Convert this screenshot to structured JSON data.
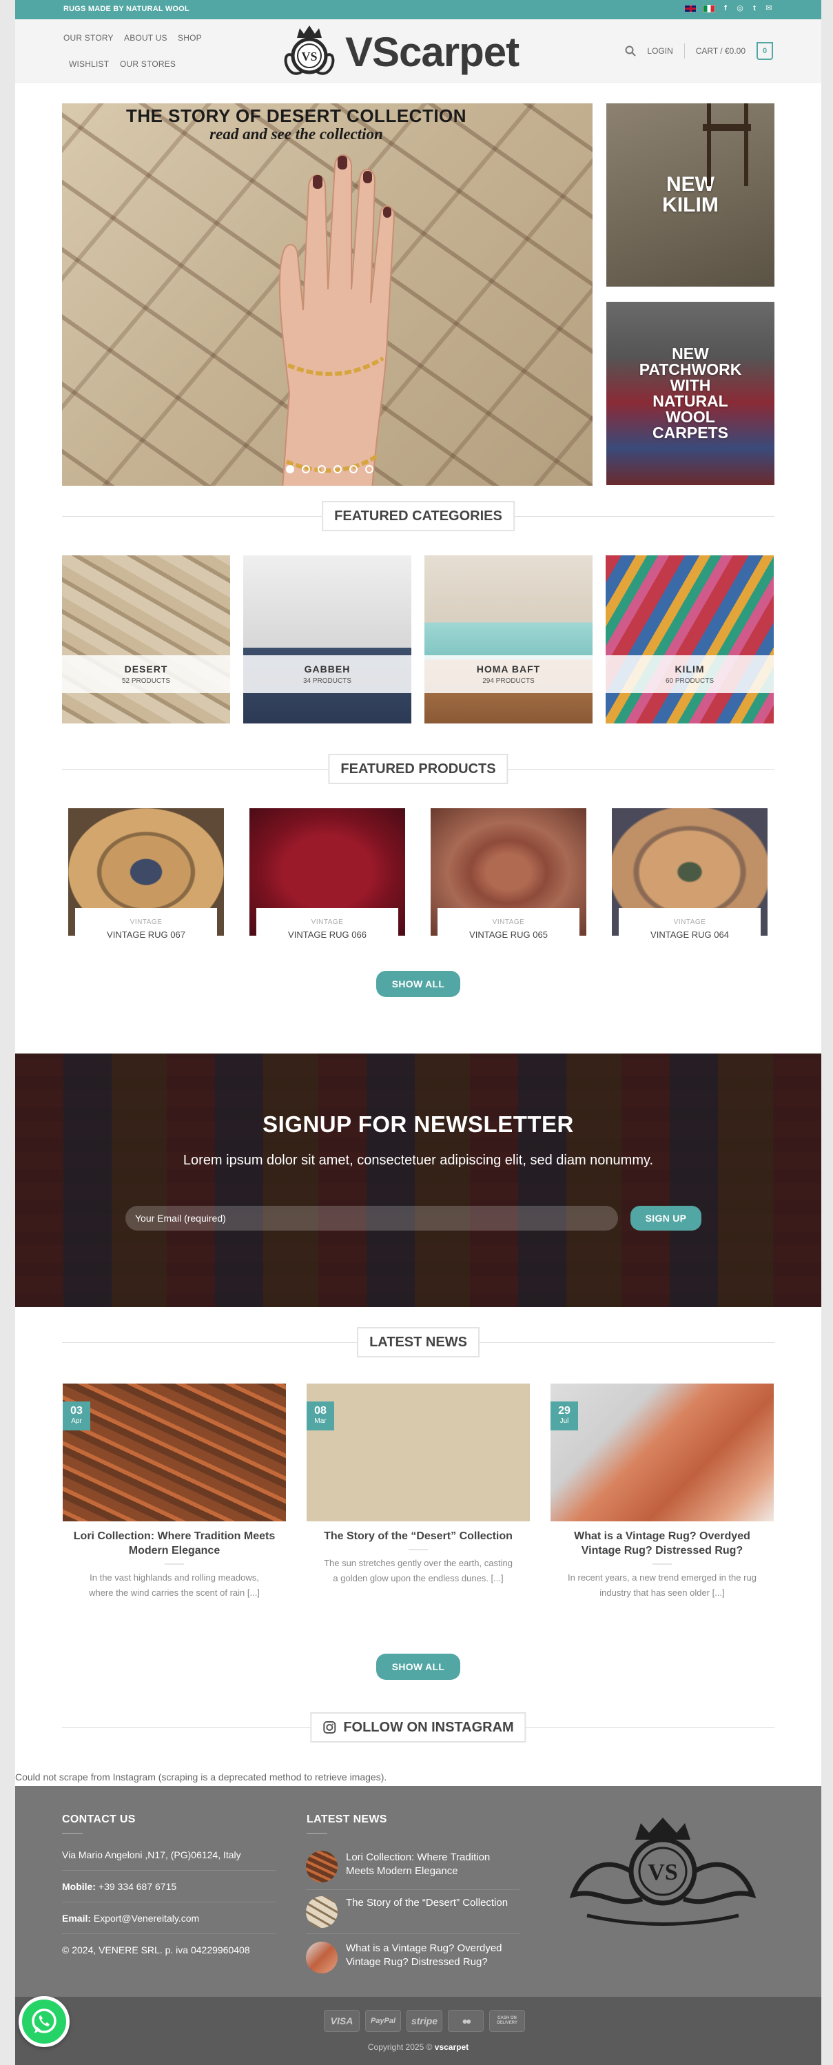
{
  "topbar": {
    "message": "RUGS MADE BY NATURAL WOOL",
    "social_icons": [
      "facebook-icon",
      "instagram-icon",
      "twitter-icon",
      "email-icon"
    ],
    "social_glyphs": [
      "f",
      "◎",
      "🐦",
      "✉"
    ]
  },
  "nav": {
    "our_story": "OUR STORY",
    "about_us": "ABOUT US",
    "shop": "SHOP",
    "wishlist": "WISHLIST",
    "our_stores": "OUR STORES"
  },
  "logo": {
    "monogram": "VS",
    "text": "VScarpet"
  },
  "header_right": {
    "login": "LOGIN",
    "cart": "CART / €0.00",
    "cart_count": "0"
  },
  "hero": {
    "title": "THE STORY OF DESERT COLLECTION",
    "subtitle": "read and see the collection",
    "slides": 6,
    "active_slide": 1
  },
  "side_banners": [
    {
      "label": "NEW\nKILIM"
    },
    {
      "label": "NEW\nPATCHWORK\nWITH\nNATURAL\nWOOL\nCARPETS"
    }
  ],
  "featured_categories": {
    "title": "FEATURED CATEGORIES",
    "items": [
      {
        "name": "DESERT",
        "count": "52 PRODUCTS"
      },
      {
        "name": "GABBEH",
        "count": "34 PRODUCTS"
      },
      {
        "name": "HOMA BAFT",
        "count": "294 PRODUCTS"
      },
      {
        "name": "KILIM",
        "count": "60 PRODUCTS"
      }
    ]
  },
  "featured_products": {
    "title": "FEATURED PRODUCTS",
    "items": [
      {
        "category": "VINTAGE",
        "name": "VINTAGE RUG 067"
      },
      {
        "category": "VINTAGE",
        "name": "VINTAGE RUG 066"
      },
      {
        "category": "VINTAGE",
        "name": "VINTAGE RUG 065"
      },
      {
        "category": "VINTAGE",
        "name": "VINTAGE RUG 064"
      }
    ],
    "show_all": "SHOW ALL"
  },
  "newsletter": {
    "title": "SIGNUP FOR NEWSLETTER",
    "text": "Lorem ipsum dolor sit amet, consectetuer adipiscing elit, sed diam nonummy.",
    "placeholder": "Your Email (required)",
    "button": "SIGN UP"
  },
  "latest_news": {
    "title": "LATEST NEWS",
    "items": [
      {
        "day": "03",
        "month": "Apr",
        "title": "Lori Collection: Where Tradition Meets Modern Elegance",
        "excerpt": "In the vast highlands and rolling meadows, where the wind carries the scent of rain [...]"
      },
      {
        "day": "08",
        "month": "Mar",
        "title": "The Story of the “Desert” Collection",
        "excerpt": "The sun stretches gently over the earth, casting a golden glow upon the endless dunes. [...]"
      },
      {
        "day": "29",
        "month": "Jul",
        "title": "What is a Vintage Rug? Overdyed Vintage Rug? Distressed Rug?",
        "excerpt": "In recent years, a new trend emerged in the rug industry that has seen older [...]"
      }
    ],
    "show_all": "SHOW ALL"
  },
  "instagram": {
    "title": "FOLLOW ON INSTAGRAM",
    "error": "Could not scrape from Instagram (scraping is a deprecated method to retrieve images)."
  },
  "footer": {
    "contact_title": "CONTACT US",
    "address": "Via Mario Angeloni ,N17, (PG)06124, Italy",
    "mobile_label": "Mobile:",
    "mobile": " +39 334 687 6715",
    "email_label": "Email:",
    "email": " Export@Venereitaly.com",
    "copyright_company": "© 2024, VENERE SRL. p. iva 04229960408",
    "news_title": "LATEST NEWS",
    "news": [
      "Lori Collection: Where Tradition Meets Modern Elegance",
      "The Story of the “Desert” Collection",
      "What is a Vintage Rug? Overdyed Vintage Rug? Distressed Rug?"
    ],
    "logo_monogram": "VS"
  },
  "bottom": {
    "payments": [
      "VISA",
      "PayPal",
      "stripe",
      "●●",
      "CASH ON DELIVERY"
    ],
    "copyright_prefix": "Copyright 2025 © ",
    "copyright_brand": "vscarpet"
  },
  "colors": {
    "accent": "#52a6a3",
    "footer": "#777777",
    "bottom": "#5b5b5b"
  }
}
